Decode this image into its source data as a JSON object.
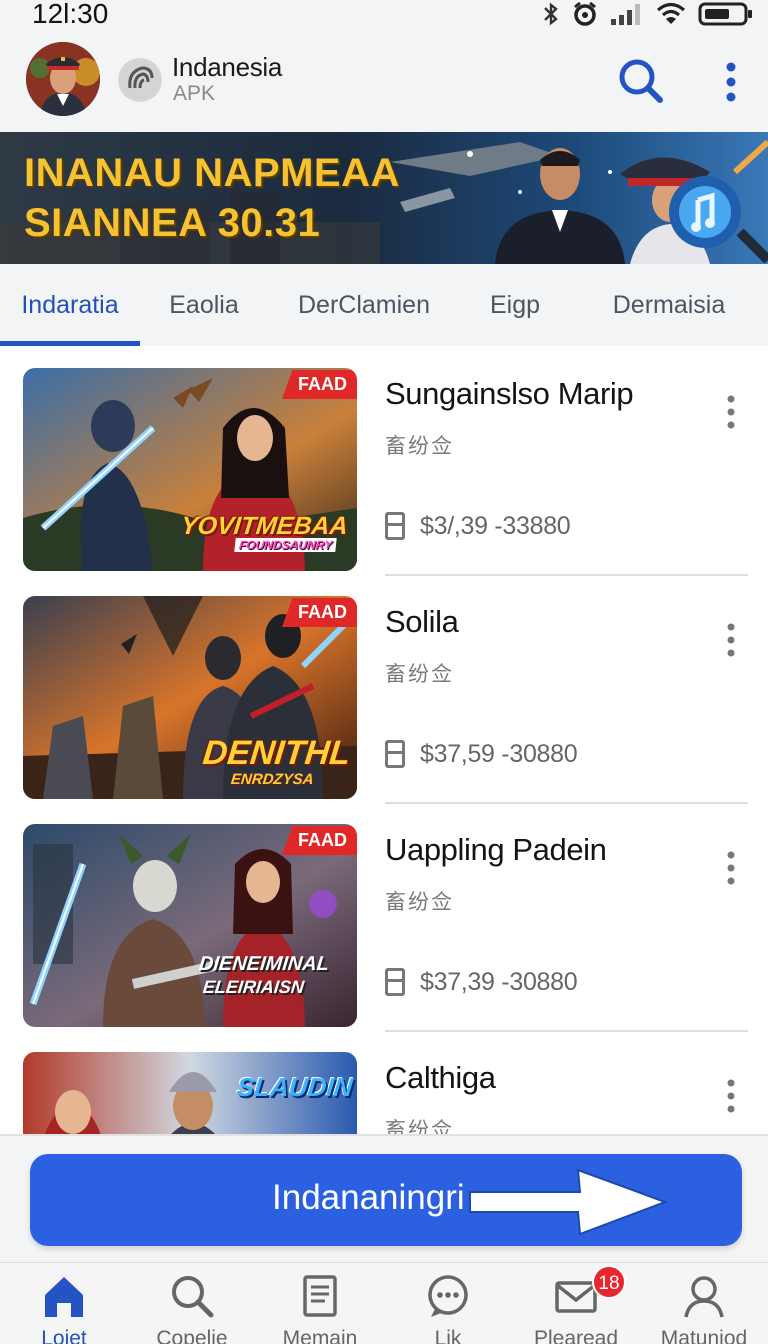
{
  "status_bar": {
    "time": "12l:30",
    "icons": [
      "bluetooth-icon",
      "alarm-icon",
      "signal-icon",
      "wifi-icon",
      "battery-icon"
    ]
  },
  "header": {
    "app_name": "Indanesia",
    "app_subtitle": "APK",
    "actions": [
      "search-icon",
      "more-vertical-icon"
    ]
  },
  "banner": {
    "title": "INANAU NAPMEAA\nSIANNEA 30.31"
  },
  "tabs": [
    {
      "label": "Indaratia",
      "active": true
    },
    {
      "label": "Eaolia",
      "active": false
    },
    {
      "label": "DerClamien",
      "active": false
    },
    {
      "label": "Eigp",
      "active": false
    },
    {
      "label": "Dermaisia",
      "active": false
    }
  ],
  "items": [
    {
      "title": "Sungainslso Marip",
      "subtitle": "畜纷佥",
      "price": "$3/,39 -33880",
      "badge": "FAAD",
      "logo_main": "YOVITMEBAA",
      "logo_sub": "FOUNDSAUNRY"
    },
    {
      "title": "Solila",
      "subtitle": "畜纷佥",
      "price": "$37,59 -30880",
      "badge": "FAAD",
      "logo_main": "DENITHL",
      "logo_sub": "ENRDZYSA"
    },
    {
      "title": "Uappling Padein",
      "subtitle": "畜纷佥",
      "price": "$37,39 -30880",
      "badge": "FAAD",
      "logo_main": "DIENEIMINAL",
      "logo_sub": "ELEIRIAISN"
    },
    {
      "title": "Calthiga",
      "subtitle": "畜纷佥",
      "price": "",
      "badge": "",
      "logo_main": "SLAUDIN",
      "logo_sub": ""
    }
  ],
  "cta": {
    "label": "Indananingri"
  },
  "bottom_nav": [
    {
      "label": "Loiet",
      "icon": "home-icon",
      "active": true
    },
    {
      "label": "Copelie",
      "icon": "search-icon",
      "active": false
    },
    {
      "label": "Memain",
      "icon": "document-icon",
      "active": false
    },
    {
      "label": "Lik",
      "icon": "chat-icon",
      "active": false
    },
    {
      "label": "Plearead",
      "icon": "mail-icon",
      "active": false,
      "badge": "18"
    },
    {
      "label": "Matuniod",
      "icon": "profile-icon",
      "active": false
    }
  ],
  "colors": {
    "accent": "#2453c4",
    "cta": "#2b61e0",
    "badge": "#e02828",
    "banner_text": "#f6c232"
  }
}
